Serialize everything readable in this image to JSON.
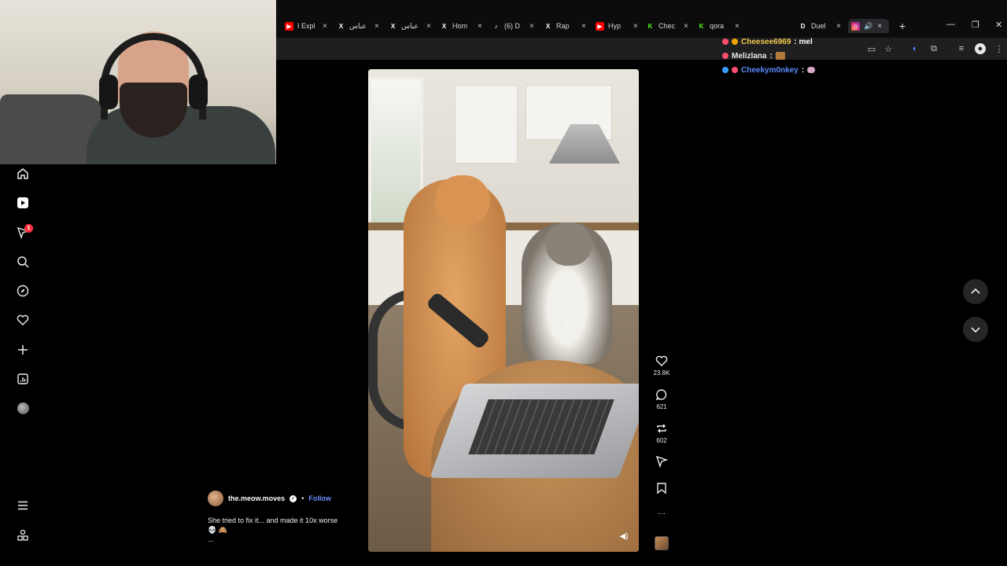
{
  "browser": {
    "tabs": [
      {
        "title": "I Expl",
        "icon": "youtube-icon",
        "color": "#ff0000"
      },
      {
        "title": "عباس",
        "icon": "x-icon",
        "color": "#ffffff"
      },
      {
        "title": "عباس",
        "icon": "x-icon",
        "color": "#ffffff"
      },
      {
        "title": "Hom",
        "icon": "x-icon",
        "color": "#ffffff"
      },
      {
        "title": "(6) D",
        "icon": "tiktok-icon",
        "color": "#ffffff"
      },
      {
        "title": "Rap",
        "icon": "x-icon",
        "color": "#ffffff"
      },
      {
        "title": "Hyp",
        "icon": "youtube-icon",
        "color": "#ff0000"
      },
      {
        "title": "Chec",
        "icon": "kick-icon",
        "color": "#53fc18"
      },
      {
        "title": "qora",
        "icon": "kick-icon",
        "color": "#53fc18"
      },
      {
        "title": "Duel",
        "icon": "d-icon",
        "color": "#ffffff"
      }
    ],
    "active_tab_icon": "instagram-icon",
    "new_tab": "+"
  },
  "chat": [
    {
      "user": "Cheesee6969",
      "message": ": mel",
      "color": "#f2c94c"
    },
    {
      "user": "Melizlana",
      "message": ":",
      "color": "#e8e8e8"
    },
    {
      "user": "Cheekym0nkey",
      "message": ":",
      "color": "#5b8cff"
    }
  ],
  "nav": {
    "notification_count": "1"
  },
  "reel": {
    "likes": "23.8K",
    "comments": "621",
    "reposts": "602",
    "author": "the.meow.moves",
    "separator": "•",
    "follow_label": "Follow",
    "caption": "She tried to fix it... and made it 10x worse",
    "caption_emoji": "💀 🙈",
    "more": "..."
  },
  "actions": {
    "more_options": "···"
  }
}
